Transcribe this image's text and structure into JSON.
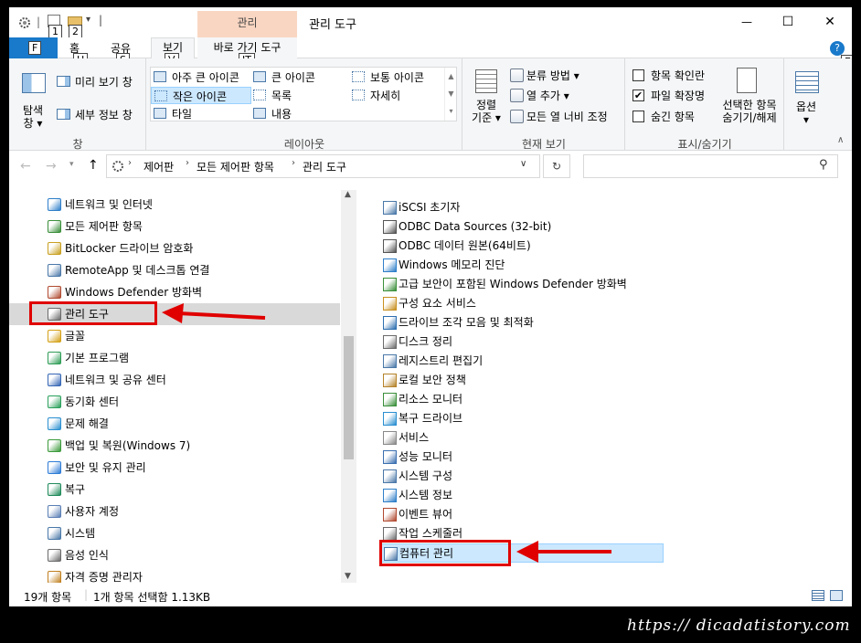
{
  "window": {
    "title": "관리 도구",
    "manage_context_tab": "관리",
    "qat_keytips": [
      "1",
      "2"
    ],
    "controls": {
      "minimize": "—",
      "maximize": "☐",
      "close": "✕"
    }
  },
  "ribbon": {
    "tabs": [
      {
        "label": "파일",
        "keytip": "F"
      },
      {
        "label": "홈",
        "keytip": "H"
      },
      {
        "label": "공유",
        "keytip": "S"
      },
      {
        "label": "보기",
        "keytip": "V"
      },
      {
        "label": "바로 가기 도구",
        "keytip": "JT"
      }
    ],
    "help_keytip": "E",
    "pane_group": {
      "label": "창",
      "nav_pane": "탐색\n창 ▾",
      "preview": "미리 보기 창",
      "details": "세부 정보 창"
    },
    "layout_group": {
      "label": "레이아웃",
      "items": [
        "아주 큰 아이콘",
        "큰 아이콘",
        "보통 아이콘",
        "작은 아이콘",
        "목록",
        "자세히",
        "타일",
        "내용"
      ],
      "selected": "작은 아이콘"
    },
    "current_view_group": {
      "label": "현재 보기",
      "sort": "정렬\n기준 ▾",
      "group_by": "분류 방법 ▾",
      "add_columns": "열 추가 ▾",
      "size_columns": "모든 열 너비 조정"
    },
    "showhide_group": {
      "label": "표시/숨기기",
      "item_checkboxes": {
        "label": "항목 확인란",
        "checked": false
      },
      "file_extensions": {
        "label": "파일 확장명",
        "checked": true
      },
      "hidden_items": {
        "label": "숨긴 항목",
        "checked": false
      },
      "hide_selected": "선택한 항목\n숨기기/해제"
    },
    "options": "옵션\n▾"
  },
  "address": {
    "path": [
      "제어판",
      "모든 제어판 항목",
      "관리 도구"
    ],
    "search_placeholder": ""
  },
  "nav_pane": {
    "items": [
      {
        "label": "네트워크 및 인터넷",
        "icon": "network-icon"
      },
      {
        "label": "모든 제어판 항목",
        "icon": "control-panel-icon"
      },
      {
        "label": "BitLocker 드라이브 암호화",
        "icon": "bitlocker-icon"
      },
      {
        "label": "RemoteApp 및 데스크톱 연결",
        "icon": "remoteapp-icon"
      },
      {
        "label": "Windows Defender 방화벽",
        "icon": "firewall-icon"
      },
      {
        "label": "관리 도구",
        "icon": "admin-tools-icon",
        "selected": true
      },
      {
        "label": "글꼴",
        "icon": "fonts-icon"
      },
      {
        "label": "기본 프로그램",
        "icon": "default-programs-icon"
      },
      {
        "label": "네트워크 및 공유 센터",
        "icon": "network-sharing-icon"
      },
      {
        "label": "동기화 센터",
        "icon": "sync-center-icon"
      },
      {
        "label": "문제 해결",
        "icon": "troubleshoot-icon"
      },
      {
        "label": "백업 및 복원(Windows 7)",
        "icon": "backup-icon"
      },
      {
        "label": "보안 및 유지 관리",
        "icon": "security-flag-icon"
      },
      {
        "label": "복구",
        "icon": "recovery-icon"
      },
      {
        "label": "사용자 계정",
        "icon": "user-accounts-icon"
      },
      {
        "label": "시스템",
        "icon": "system-icon"
      },
      {
        "label": "음성 인식",
        "icon": "microphone-icon"
      },
      {
        "label": "자격 증명 관리자",
        "icon": "credential-icon"
      }
    ]
  },
  "files": [
    "iSCSI 초기자",
    "ODBC Data Sources (32-bit)",
    "ODBC 데이터 원본(64비트)",
    "Windows 메모리 진단",
    "고급 보안이 포함된 Windows Defender 방화벽",
    "구성 요소 서비스",
    "드라이브 조각 모음 및 최적화",
    "디스크 정리",
    "레지스트리 편집기",
    "로컬 보안 정책",
    "리소스 모니터",
    "복구 드라이브",
    "서비스",
    "성능 모니터",
    "시스템 구성",
    "시스템 정보",
    "이벤트 뷰어",
    "작업 스케줄러",
    "컴퓨터 관리"
  ],
  "selected_file": "컴퓨터 관리",
  "status": {
    "count": "19개 항목",
    "selection": "1개 항목 선택함 1.13KB"
  },
  "watermark": "https:// dicadatistory.com",
  "colors": {
    "file_tab": "#1979ca",
    "context_tab": "#f9d6c2",
    "selection": "#cce8ff",
    "highlight_box": "#e00000"
  }
}
